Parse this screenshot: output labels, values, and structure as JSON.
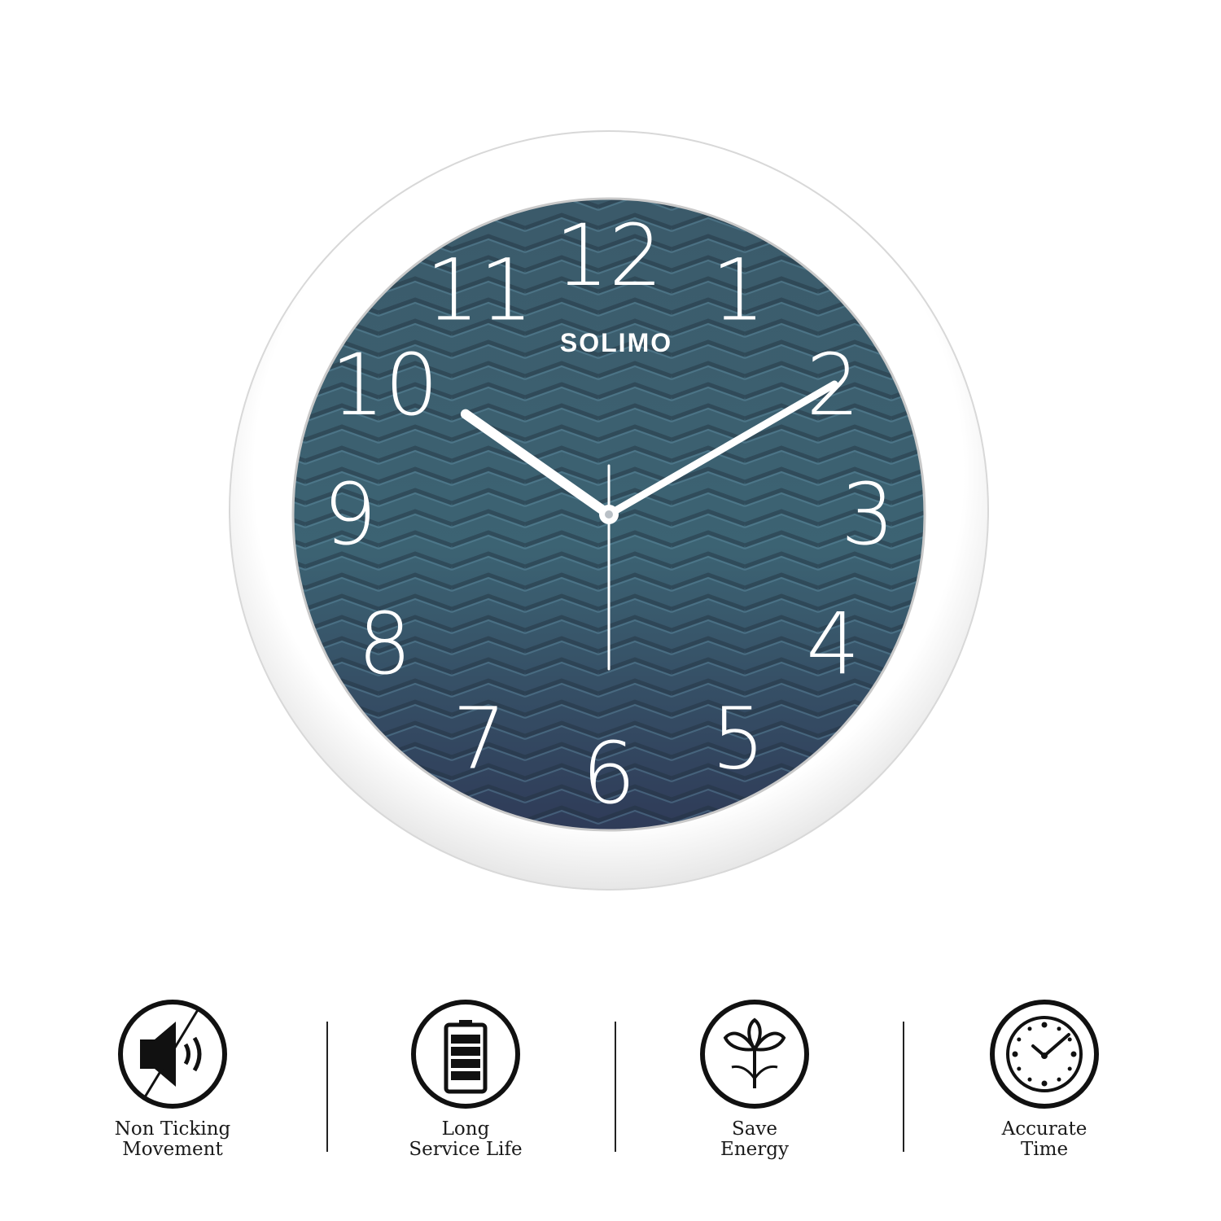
{
  "clock": {
    "brand": "SOLIMO",
    "numerals": [
      "12",
      "1",
      "2",
      "3",
      "4",
      "5",
      "6",
      "7",
      "8",
      "9",
      "10",
      "11"
    ],
    "time": {
      "hour": 10,
      "minute": 10,
      "second": 30
    },
    "colors": {
      "frame": "#ffffff",
      "dial_top": "#3c6170",
      "dial_bottom": "#2e3a56",
      "hands": "#ffffff"
    }
  },
  "features": [
    {
      "icon": "speaker-muted-icon",
      "line1": "Non Ticking",
      "line2": "Movement"
    },
    {
      "icon": "battery-icon",
      "line1": "Long",
      "line2": "Service Life"
    },
    {
      "icon": "energy-icon",
      "line1": "Save",
      "line2": "Energy"
    },
    {
      "icon": "clock-icon",
      "line1": "Accurate",
      "line2": "Time"
    }
  ]
}
